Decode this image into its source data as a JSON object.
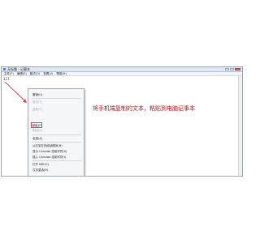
{
  "window": {
    "title": "无标题 - 记事本"
  },
  "menubar": {
    "items": [
      "文件(F)",
      "编辑(E)",
      "格式(O)",
      "查看(V)",
      "帮助(H)"
    ]
  },
  "editor": {
    "text": "111"
  },
  "context_menu": {
    "items": [
      {
        "label": "撤销(U)",
        "enabled": true
      },
      {
        "label": "剪切(T)",
        "enabled": false
      },
      {
        "label": "复制(C)",
        "enabled": false
      },
      {
        "label": "粘贴(P)",
        "enabled": true
      },
      {
        "label": "删除(D)",
        "enabled": false
      },
      {
        "label": "全选(A)",
        "enabled": true
      },
      {
        "label": "从右到左的阅读顺序(R)",
        "enabled": true
      },
      {
        "label": "显示 Unicode 控制字符(S)",
        "enabled": true
      },
      {
        "label": "插入 Unicode 控制字符(I)",
        "enabled": true
      },
      {
        "label": "打开 IME(O)",
        "enabled": true
      },
      {
        "label": "汉字重选(R)",
        "enabled": true
      }
    ]
  },
  "annotation": {
    "text": "将手机端复制的文本，粘贴到电脑记事本"
  },
  "colors": {
    "annotation": "#a8181c",
    "highlight": "#e04848"
  }
}
